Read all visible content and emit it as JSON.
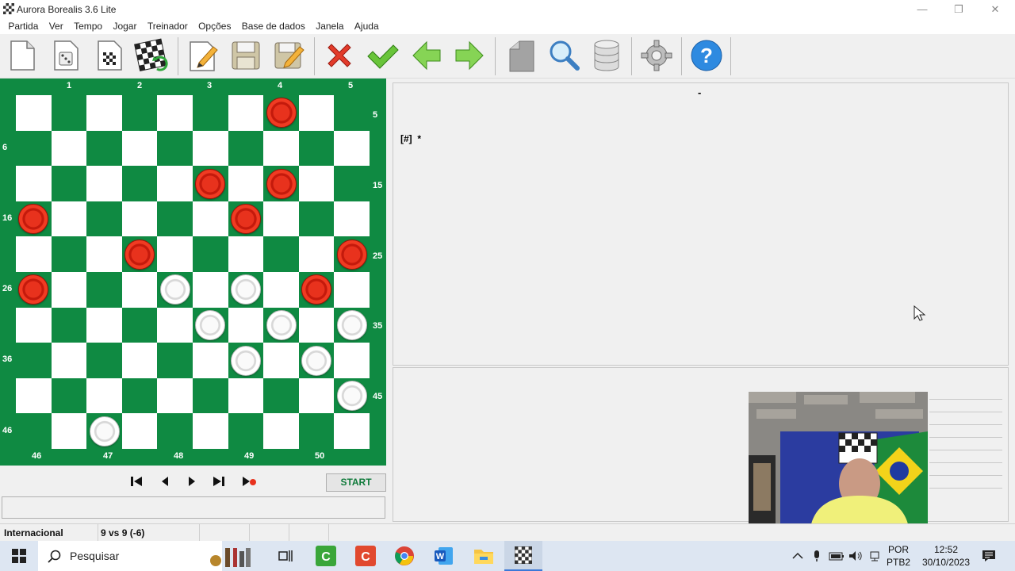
{
  "window": {
    "title": "Aurora Borealis 3.6 Lite",
    "minimize_icon": "—",
    "restore_icon": "❐",
    "close_icon": "✕"
  },
  "menu": [
    "Partida",
    "Ver",
    "Tempo",
    "Jogar",
    "Treinador",
    "Opções",
    "Base de dados",
    "Janela",
    "Ajuda"
  ],
  "toolbar": {
    "icons": [
      "new-game",
      "setup-position",
      "board-diagram",
      "flip-board",
      "edit",
      "save",
      "save-edit",
      "cancel",
      "confirm",
      "back",
      "forward",
      "page",
      "search",
      "database",
      "settings",
      "help"
    ]
  },
  "board": {
    "top_coords": [
      "1",
      "2",
      "3",
      "4",
      "5"
    ],
    "bottom_coords": [
      "46",
      "47",
      "48",
      "49",
      "50"
    ],
    "left_coords": [
      "6",
      "16",
      "26",
      "36",
      "46"
    ],
    "right_coords": [
      "5",
      "15",
      "25",
      "35",
      "45"
    ],
    "red_pieces": [
      4,
      13,
      14,
      16,
      19,
      22,
      25,
      26,
      30
    ],
    "white_pieces": [
      28,
      29,
      33,
      34,
      35,
      39,
      40,
      45,
      47
    ],
    "colors": {
      "dark": "#0f8a42",
      "light": "#ffffff",
      "red": "#e8321d",
      "white": "#fafafa"
    }
  },
  "nav": {
    "start_label": "START",
    "icons": [
      "first-move",
      "previous-move",
      "next-move",
      "last-move",
      "play-variation"
    ]
  },
  "notation": {
    "header": "-",
    "line": "[#]  *"
  },
  "status": {
    "variant": "Internacional",
    "score": "9 vs 9  (-6)"
  },
  "taskbar": {
    "search_placeholder": "Pesquisar",
    "lang_top": "POR",
    "lang_bottom": "PTB2",
    "time": "12:52",
    "date": "30/10/2023"
  }
}
